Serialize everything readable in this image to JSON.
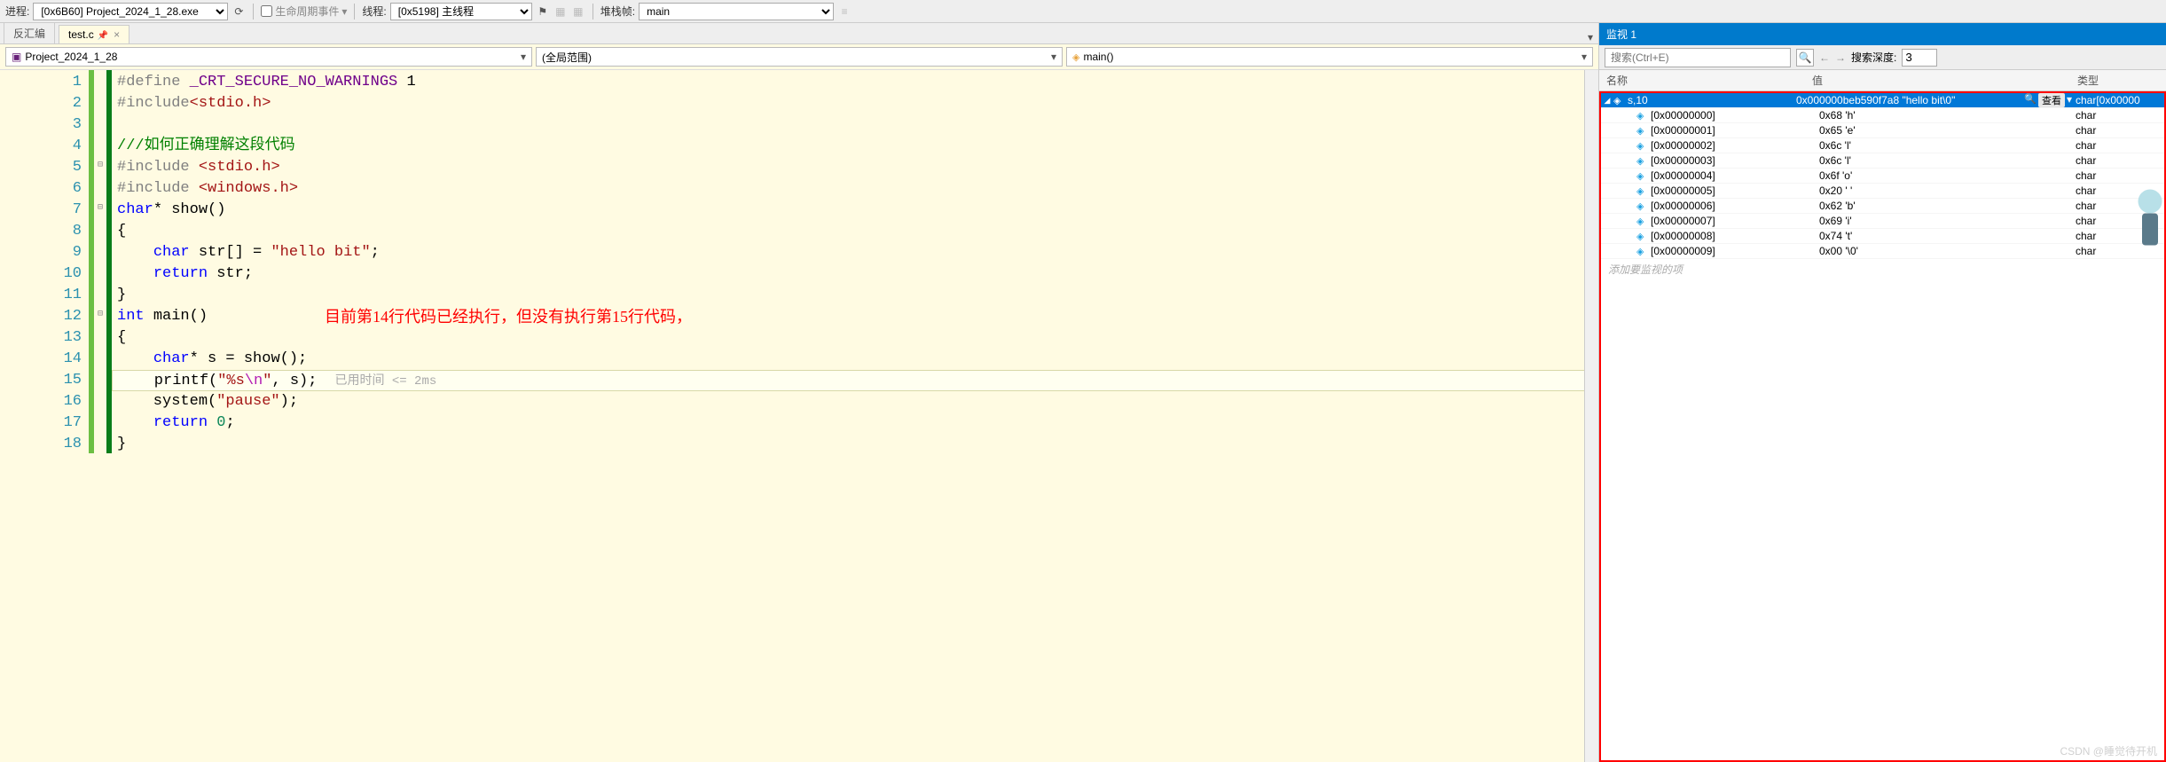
{
  "toolbar": {
    "process_label": "进程:",
    "process_value": "[0x6B60] Project_2024_1_28.exe",
    "lifecycle_label": "生命周期事件",
    "thread_label": "线程:",
    "thread_value": "[0x5198] 主线程",
    "stack_label": "堆栈帧:",
    "stack_value": "main"
  },
  "tabs": {
    "disasm": "反汇编",
    "file": "test.c"
  },
  "nav": {
    "project": "Project_2024_1_28",
    "scope": "(全局范围)",
    "func": "main()"
  },
  "code": {
    "lines": [
      {
        "n": 1,
        "pre": "#define ",
        "macro": "_CRT_SECURE_NO_WARNINGS",
        "rest": " 1"
      },
      {
        "n": 2,
        "pre": "#include",
        "inc": "<stdio.h>"
      },
      {
        "n": 3
      },
      {
        "n": 4,
        "cmt": "///如何正确理解这段代码"
      },
      {
        "n": 5,
        "pre": "#include ",
        "inc": "<stdio.h>",
        "fold": true
      },
      {
        "n": 6,
        "pre": "#include ",
        "inc": "<windows.h>"
      },
      {
        "n": 7,
        "sig": "char* show()",
        "fold": true
      },
      {
        "n": 8,
        "brace": "{"
      },
      {
        "n": 9,
        "decl": "char str[] = ",
        "str": "\"hello bit\"",
        "end": ";"
      },
      {
        "n": 10,
        "ret": "return str;"
      },
      {
        "n": 11,
        "brace": "}"
      },
      {
        "n": 12,
        "sig": "int main()",
        "fold": true
      },
      {
        "n": 13,
        "brace": "{"
      },
      {
        "n": 14,
        "call": "char* s = show();"
      },
      {
        "n": 15,
        "printf": "printf(",
        "fmt": "\"%s",
        "esc": "\\n",
        "fmt2": "\"",
        "args": ", s);",
        "hint": "已用时间 <= 2ms",
        "current": true
      },
      {
        "n": 16,
        "sys": "system(",
        "str": "\"pause\"",
        "end": ");"
      },
      {
        "n": 17,
        "ret": "return 0;"
      },
      {
        "n": 18,
        "brace": "}"
      }
    ],
    "annotation": "目前第14行代码已经执行，但没有执行第15行代码，"
  },
  "watch": {
    "title": "监视 1",
    "search_placeholder": "搜索(Ctrl+E)",
    "depth_label": "搜索深度:",
    "depth_value": "3",
    "cols": {
      "name": "名称",
      "value": "值",
      "type": "类型"
    },
    "root": {
      "name": "s,10",
      "value": "0x000000beb590f7a8 \"hello bit\\0\"",
      "type": "char[0x00000",
      "view": "查看"
    },
    "items": [
      {
        "idx": "[0x00000000]",
        "val": "0x68 'h'",
        "type": "char"
      },
      {
        "idx": "[0x00000001]",
        "val": "0x65 'e'",
        "type": "char"
      },
      {
        "idx": "[0x00000002]",
        "val": "0x6c 'l'",
        "type": "char"
      },
      {
        "idx": "[0x00000003]",
        "val": "0x6c 'l'",
        "type": "char"
      },
      {
        "idx": "[0x00000004]",
        "val": "0x6f 'o'",
        "type": "char"
      },
      {
        "idx": "[0x00000005]",
        "val": "0x20 ' '",
        "type": "char"
      },
      {
        "idx": "[0x00000006]",
        "val": "0x62 'b'",
        "type": "char"
      },
      {
        "idx": "[0x00000007]",
        "val": "0x69 'i'",
        "type": "char"
      },
      {
        "idx": "[0x00000008]",
        "val": "0x74 't'",
        "type": "char"
      },
      {
        "idx": "[0x00000009]",
        "val": "0x00 '\\0'",
        "type": "char"
      }
    ],
    "add_hint": "添加要监视的项"
  },
  "watermark": "CSDN @睡觉待开机"
}
